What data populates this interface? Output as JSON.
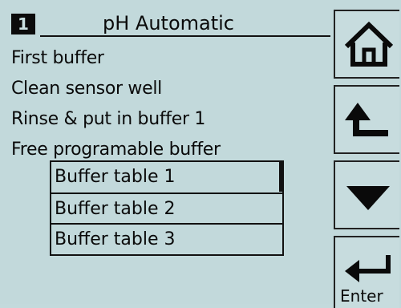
{
  "header": {
    "channel": "1",
    "title": "pH Automatic"
  },
  "menu": {
    "items": [
      {
        "label": "First buffer"
      },
      {
        "label": "Clean sensor well"
      },
      {
        "label": "Rinse & put in buffer 1"
      },
      {
        "label": "Free programable buffer"
      }
    ]
  },
  "submenu": {
    "items": [
      {
        "label": "Buffer table 1",
        "selected": true
      },
      {
        "label": "Buffer table 2",
        "selected": false
      },
      {
        "label": "Buffer table 3",
        "selected": false
      }
    ]
  },
  "side_buttons": {
    "home_icon": "home-icon",
    "back_icon": "return-arrow-icon",
    "down_icon": "triangle-down-icon",
    "enter_icon": "enter-arrow-icon",
    "enter_label": "Enter"
  },
  "colors": {
    "screen_background": "#c2d9db",
    "ink": "#0a0a0a"
  }
}
